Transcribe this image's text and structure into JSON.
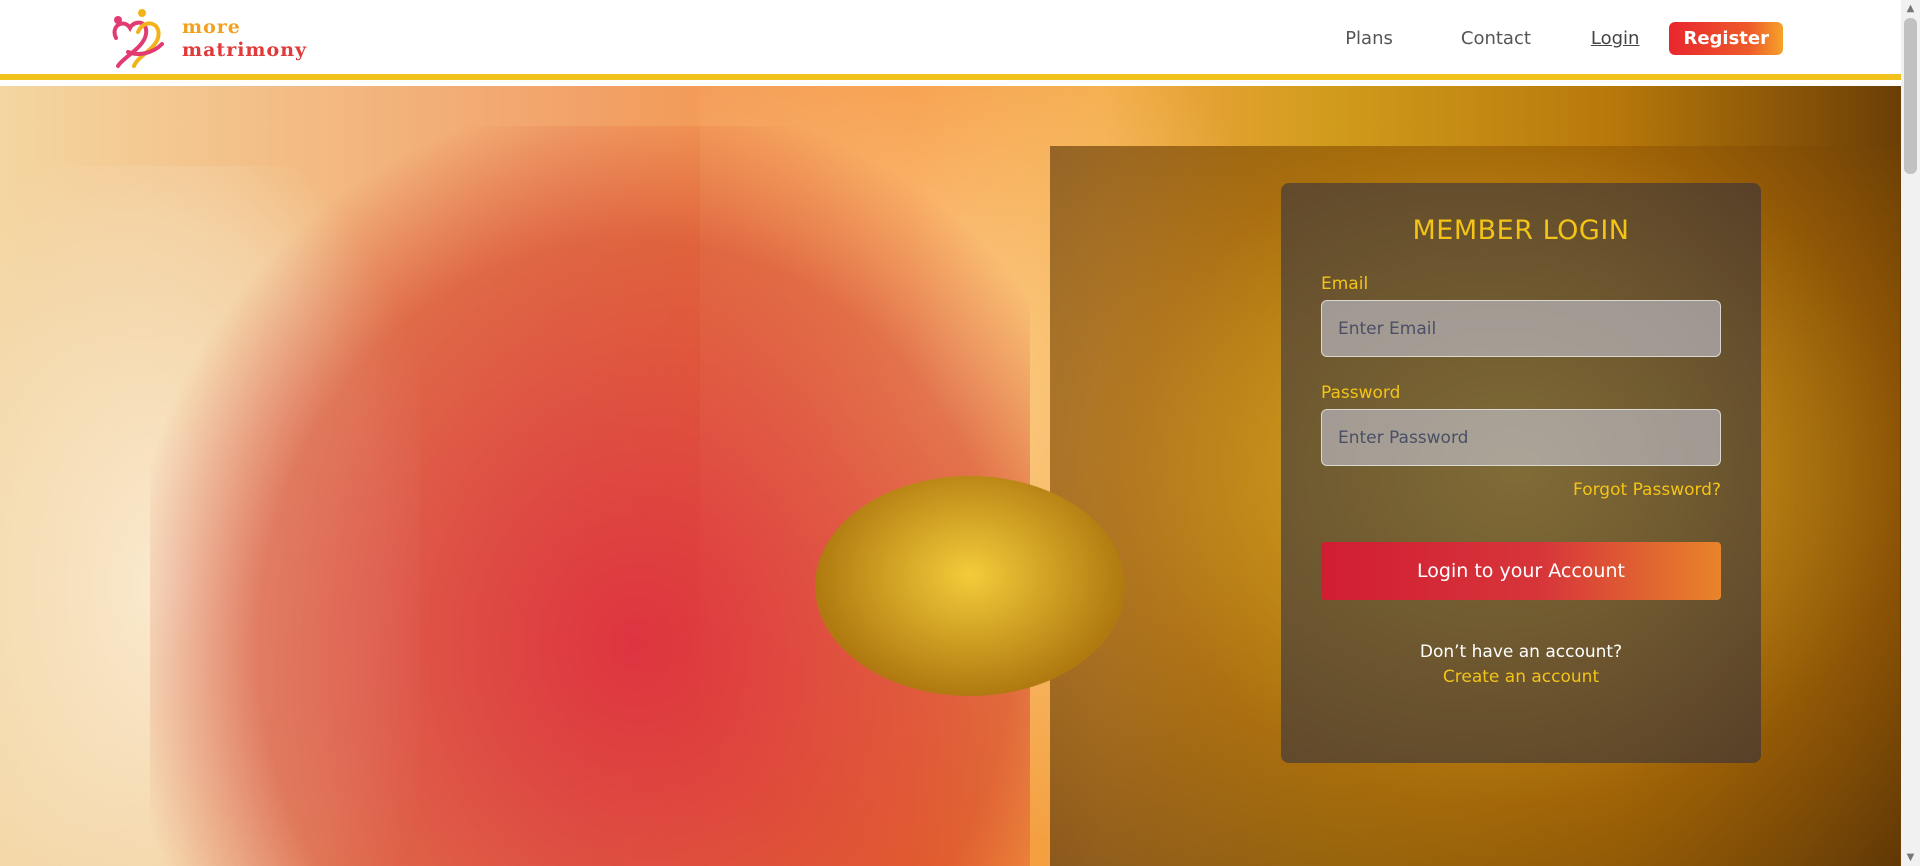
{
  "brand": {
    "line1": "more",
    "line2": "matrimony"
  },
  "nav": {
    "plans": "Plans",
    "contact": "Contact",
    "login": "Login",
    "register": "Register"
  },
  "login": {
    "title": "MEMBER LOGIN",
    "email_label": "Email",
    "email_placeholder": "Enter Email",
    "password_label": "Password",
    "password_placeholder": "Enter Password",
    "forgot": "Forgot Password?",
    "submit": "Login to your Account",
    "no_account": "Don’t have an account?",
    "create": "Create an account"
  },
  "colors": {
    "accent": "#f3c416",
    "brand_red": "#e8262e"
  }
}
